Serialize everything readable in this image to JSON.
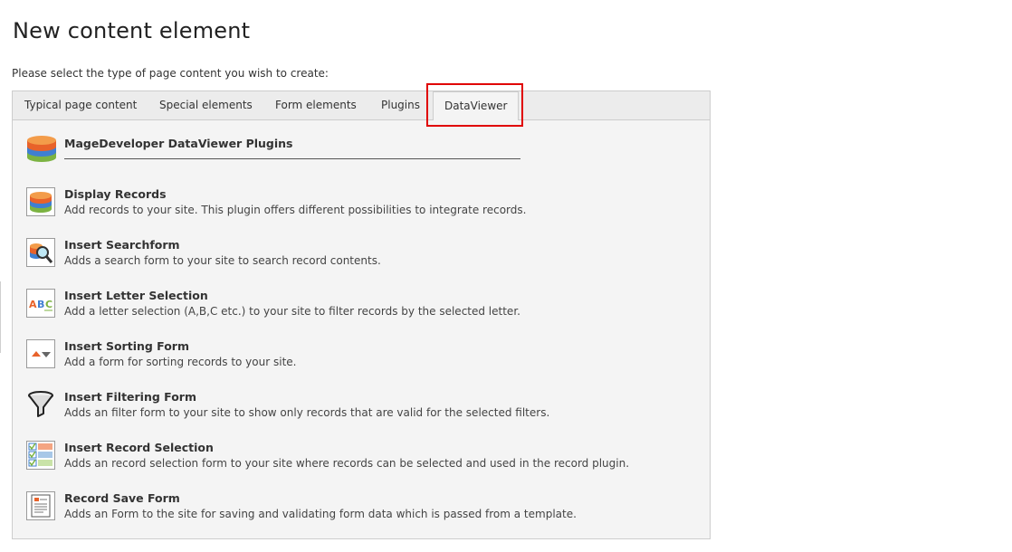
{
  "page": {
    "title": "New content element",
    "prompt": "Please select the type of page content you wish to create:"
  },
  "tabs": [
    {
      "label": "Typical page content",
      "active": false
    },
    {
      "label": "Special elements",
      "active": false
    },
    {
      "label": "Form elements",
      "active": false
    },
    {
      "label": "Plugins",
      "active": false
    },
    {
      "label": "DataViewer",
      "active": true
    }
  ],
  "colors": {
    "highlight": "#e00000",
    "panel_bg": "#f4f4f4",
    "tabbar_bg": "#ececec"
  },
  "header_item": {
    "title": "MageDeveloper DataViewer Plugins",
    "icon": "database-stack-icon"
  },
  "items": [
    {
      "title": "Display Records",
      "desc": "Add records to your site. This plugin offers different possibilities to integrate records.",
      "icon": "database-icon"
    },
    {
      "title": "Insert Searchform",
      "desc": "Adds a search form to your site to search record contents.",
      "icon": "search-database-icon"
    },
    {
      "title": "Insert Letter Selection",
      "desc": "Add a letter selection (A,B,C etc.) to your site to filter records by the selected letter.",
      "icon": "abc-icon"
    },
    {
      "title": "Insert Sorting Form",
      "desc": "Add a form for sorting records to your site.",
      "icon": "sort-icon"
    },
    {
      "title": "Insert Filtering Form",
      "desc": "Adds an filter form to your site to show only records that are valid for the selected filters.",
      "icon": "funnel-icon"
    },
    {
      "title": "Insert Record Selection",
      "desc": "Adds an record selection form to your site where records can be selected and used in the record plugin.",
      "icon": "checklist-icon"
    },
    {
      "title": "Record Save Form",
      "desc": "Adds an Form to the site for saving and validating form data which is passed from a template.",
      "icon": "form-document-icon"
    }
  ]
}
